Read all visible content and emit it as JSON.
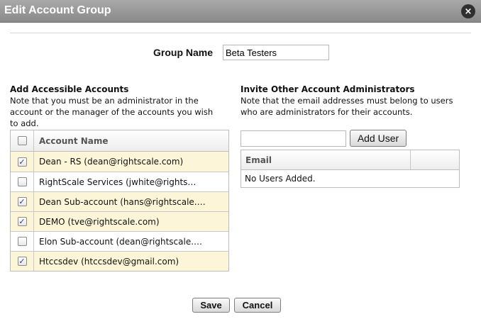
{
  "dialog": {
    "title": "Edit Account Group",
    "close_glyph": "×"
  },
  "group_name": {
    "label": "Group Name",
    "value": "Beta Testers"
  },
  "accounts": {
    "title": "Add Accessible Accounts",
    "note": "Note that you must be an administrator in the account or the manager of the accounts you wish to add.",
    "column_header": "Account Name",
    "header_checked": false,
    "rows": [
      {
        "name": "Dean - RS (dean@rightscale.com)",
        "checked": true
      },
      {
        "name": "RightScale Services (jwhite@rights…",
        "checked": false
      },
      {
        "name": "Dean Sub-account (hans@rightscale.…",
        "checked": true
      },
      {
        "name": "DEMO (tve@rightscale.com)",
        "checked": true
      },
      {
        "name": "Elon Sub-account (dean@rightscale.…",
        "checked": false
      },
      {
        "name": "Htccsdev (htccsdev@gmail.com)",
        "checked": true
      }
    ]
  },
  "invite": {
    "title": "Invite Other Account Administrators",
    "note": "Note that the email addresses must belong to users who are administrators for their accounts.",
    "email_value": "",
    "add_user_label": "Add User",
    "column_header": "Email",
    "empty_text": "No Users Added."
  },
  "footer": {
    "save_label": "Save",
    "cancel_label": "Cancel"
  },
  "colors": {
    "titlebar": "#8f8f8f",
    "selected_row": "#fdf5d8",
    "checkmark": "#2b3f82"
  }
}
